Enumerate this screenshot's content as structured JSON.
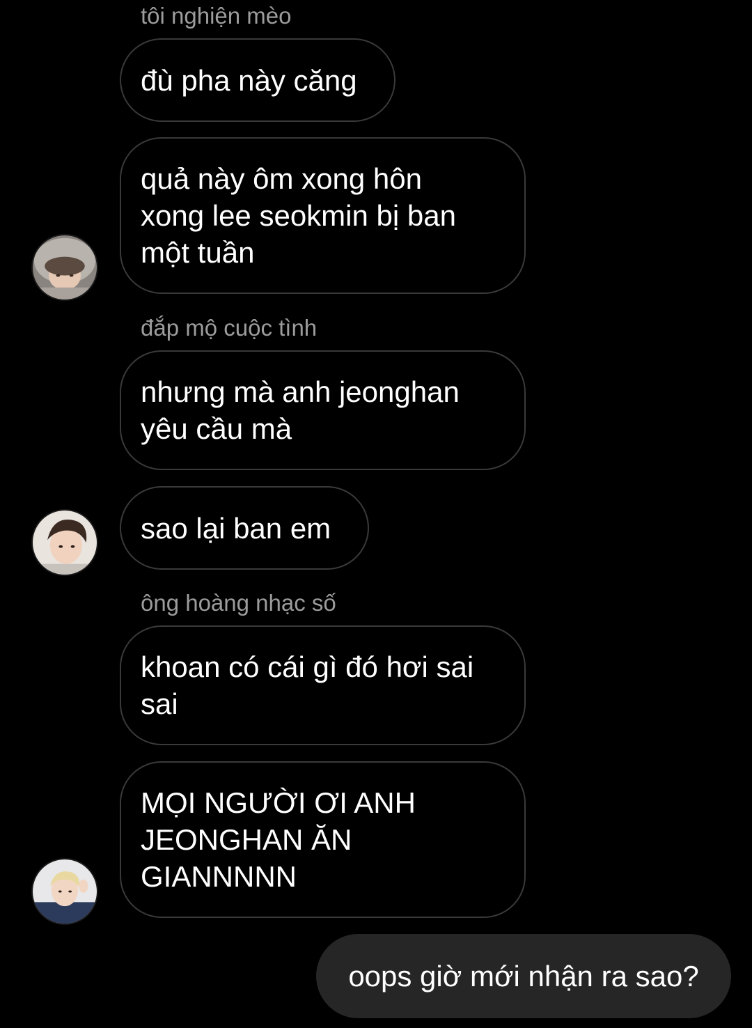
{
  "thread": {
    "messages": [
      {
        "sender": "tôi nghiện mèo",
        "text_lines": [
          "đù pha này căng"
        ]
      },
      {
        "text_lines": [
          "quả này ôm xong hôn",
          "xong lee seokmin bị ban",
          "một tuần"
        ],
        "avatar": "avatar-1"
      },
      {
        "sender": "đắp mộ cuộc tình",
        "text_lines": [
          "nhưng mà anh jeonghan",
          "yêu cầu mà"
        ]
      },
      {
        "text_lines": [
          "sao lại ban em"
        ],
        "avatar": "avatar-2"
      },
      {
        "sender": "ông hoàng nhạc số",
        "text_lines": [
          "khoan có cái gì đó hơi sai",
          "sai"
        ]
      },
      {
        "text_lines": [
          "MỌI NGƯỜI ƠI ANH",
          "JEONGHAN ĂN",
          "GIANNNNN"
        ],
        "avatar": "avatar-3"
      },
      {
        "outgoing": true,
        "text_lines": [
          "oops giờ mới nhận ra sao?"
        ]
      }
    ]
  },
  "colors": {
    "background": "#000000",
    "bubble_border": "#3a3a3a",
    "outgoing_bubble": "#262626",
    "sender_name": "#9c9c9c",
    "text": "#ffffff"
  }
}
